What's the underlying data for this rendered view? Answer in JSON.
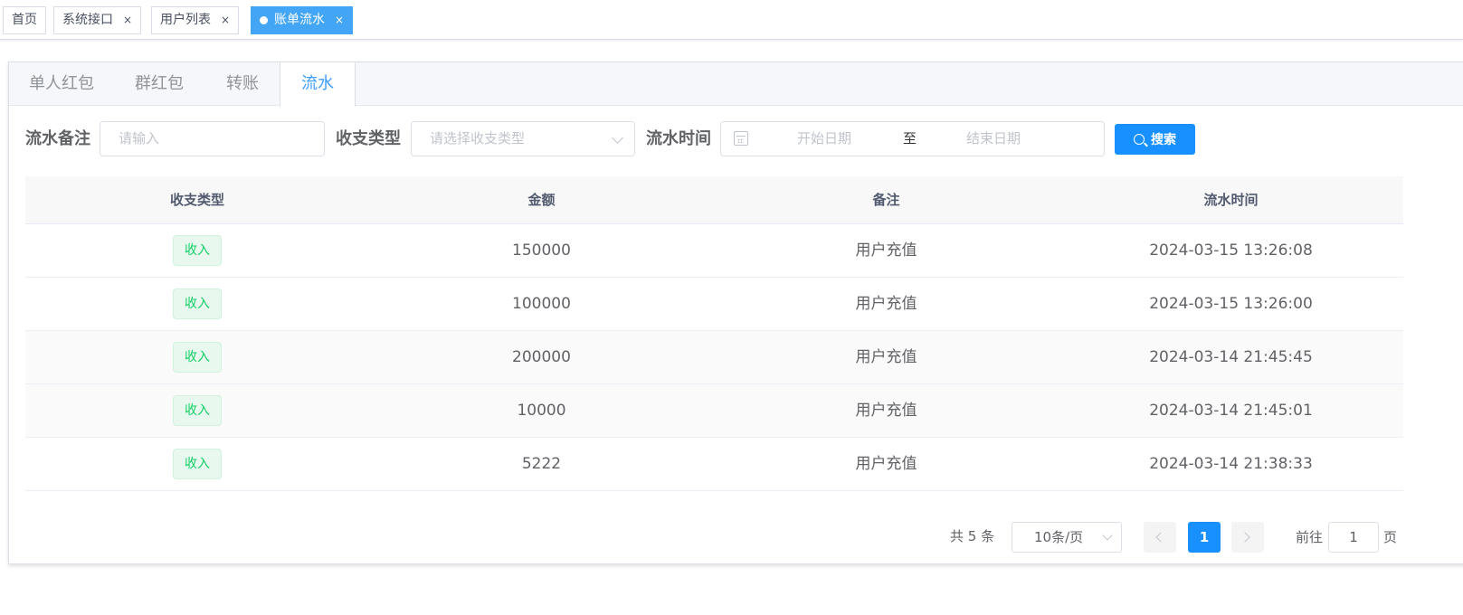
{
  "tags": [
    {
      "label": "首页",
      "closable": false,
      "active": false
    },
    {
      "label": "系统接口",
      "closable": true,
      "active": false
    },
    {
      "label": "用户列表",
      "closable": true,
      "active": false
    },
    {
      "label": "账单流水",
      "closable": true,
      "active": true
    }
  ],
  "close_glyph": "×",
  "tabs": [
    {
      "label": "单人红包",
      "active": false
    },
    {
      "label": "群红包",
      "active": false
    },
    {
      "label": "转账",
      "active": false
    },
    {
      "label": "流水",
      "active": true
    }
  ],
  "filters": {
    "remark_label": "流水备注",
    "remark_placeholder": "请输入",
    "type_label": "收支类型",
    "type_placeholder": "请选择收支类型",
    "time_label": "流水时间",
    "start_placeholder": "开始日期",
    "range_separator": "至",
    "end_placeholder": "结束日期",
    "search_label": "搜索"
  },
  "table": {
    "columns": [
      "收支类型",
      "金额",
      "备注",
      "流水时间"
    ],
    "rows": [
      {
        "type": "收入",
        "amount": "150000",
        "remark": "用户充值",
        "time": "2024-03-15 13:26:08"
      },
      {
        "type": "收入",
        "amount": "100000",
        "remark": "用户充值",
        "time": "2024-03-15 13:26:00"
      },
      {
        "type": "收入",
        "amount": "200000",
        "remark": "用户充值",
        "time": "2024-03-14 21:45:45"
      },
      {
        "type": "收入",
        "amount": "10000",
        "remark": "用户充值",
        "time": "2024-03-14 21:45:01"
      },
      {
        "type": "收入",
        "amount": "5222",
        "remark": "用户充值",
        "time": "2024-03-14 21:38:33"
      }
    ]
  },
  "pagination": {
    "total_text": "共 5 条",
    "page_size": "10条/页",
    "current_page": "1",
    "goto_prefix": "前往",
    "goto_value": "1",
    "goto_suffix": "页"
  },
  "colors": {
    "primary": "#1890ff",
    "active_tag": "#42a5f5",
    "income_badge_text": "#13ce66",
    "income_badge_bg": "#e8f8ee"
  }
}
